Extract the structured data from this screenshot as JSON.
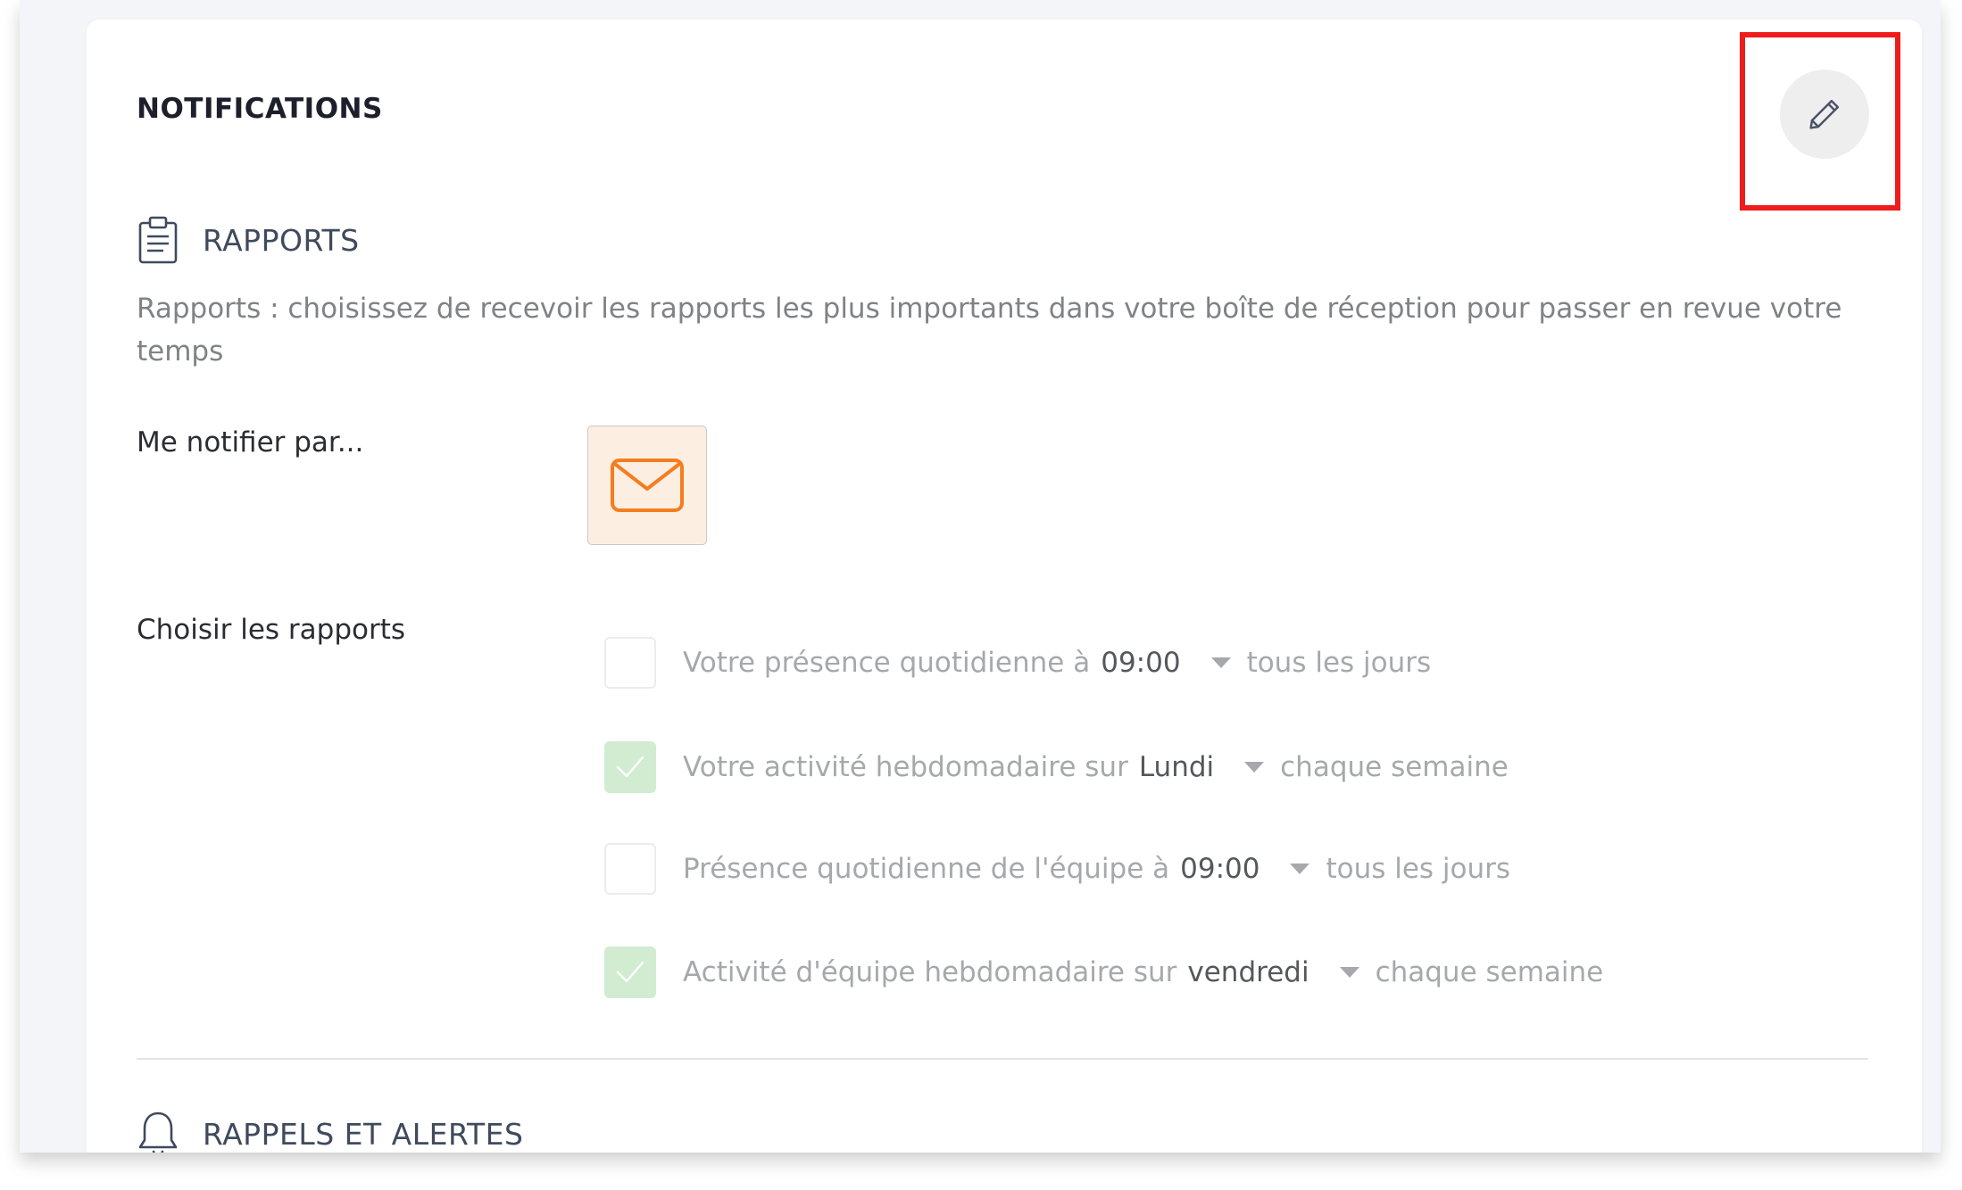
{
  "card": {
    "title": "NOTIFICATIONS"
  },
  "icons": {
    "edit": "pencil-icon",
    "reports": "clipboard-icon",
    "email": "envelope-icon",
    "reminders": "bell-icon",
    "check": "check-icon",
    "dropdown": "caret-down-icon"
  },
  "colors": {
    "highlight": "#ee1c1c",
    "email_accent": "#f47d20",
    "email_bg": "#fdeee2",
    "checked_bg": "#d1ecd1"
  },
  "reports_section": {
    "title": "RAPPORTS",
    "description": "Rapports : choisissez de recevoir les rapports les plus importants dans votre boîte de réception pour passer en revue votre temps",
    "notify_label": "Me notifier par...",
    "choose_label": "Choisir les rapports",
    "items": [
      {
        "checked": false,
        "text": "Votre présence quotidienne à",
        "value": "09:00",
        "frequency": "tous les jours"
      },
      {
        "checked": true,
        "text": "Votre activité hebdomadaire sur",
        "value": "Lundi",
        "frequency": "chaque semaine"
      },
      {
        "checked": false,
        "text": "Présence quotidienne de l'équipe à",
        "value": "09:00",
        "frequency": "tous les jours"
      },
      {
        "checked": true,
        "text": "Activité d'équipe hebdomadaire sur",
        "value": "vendredi",
        "frequency": "chaque semaine"
      }
    ]
  },
  "reminders_section": {
    "title": "RAPPELS ET ALERTES"
  }
}
